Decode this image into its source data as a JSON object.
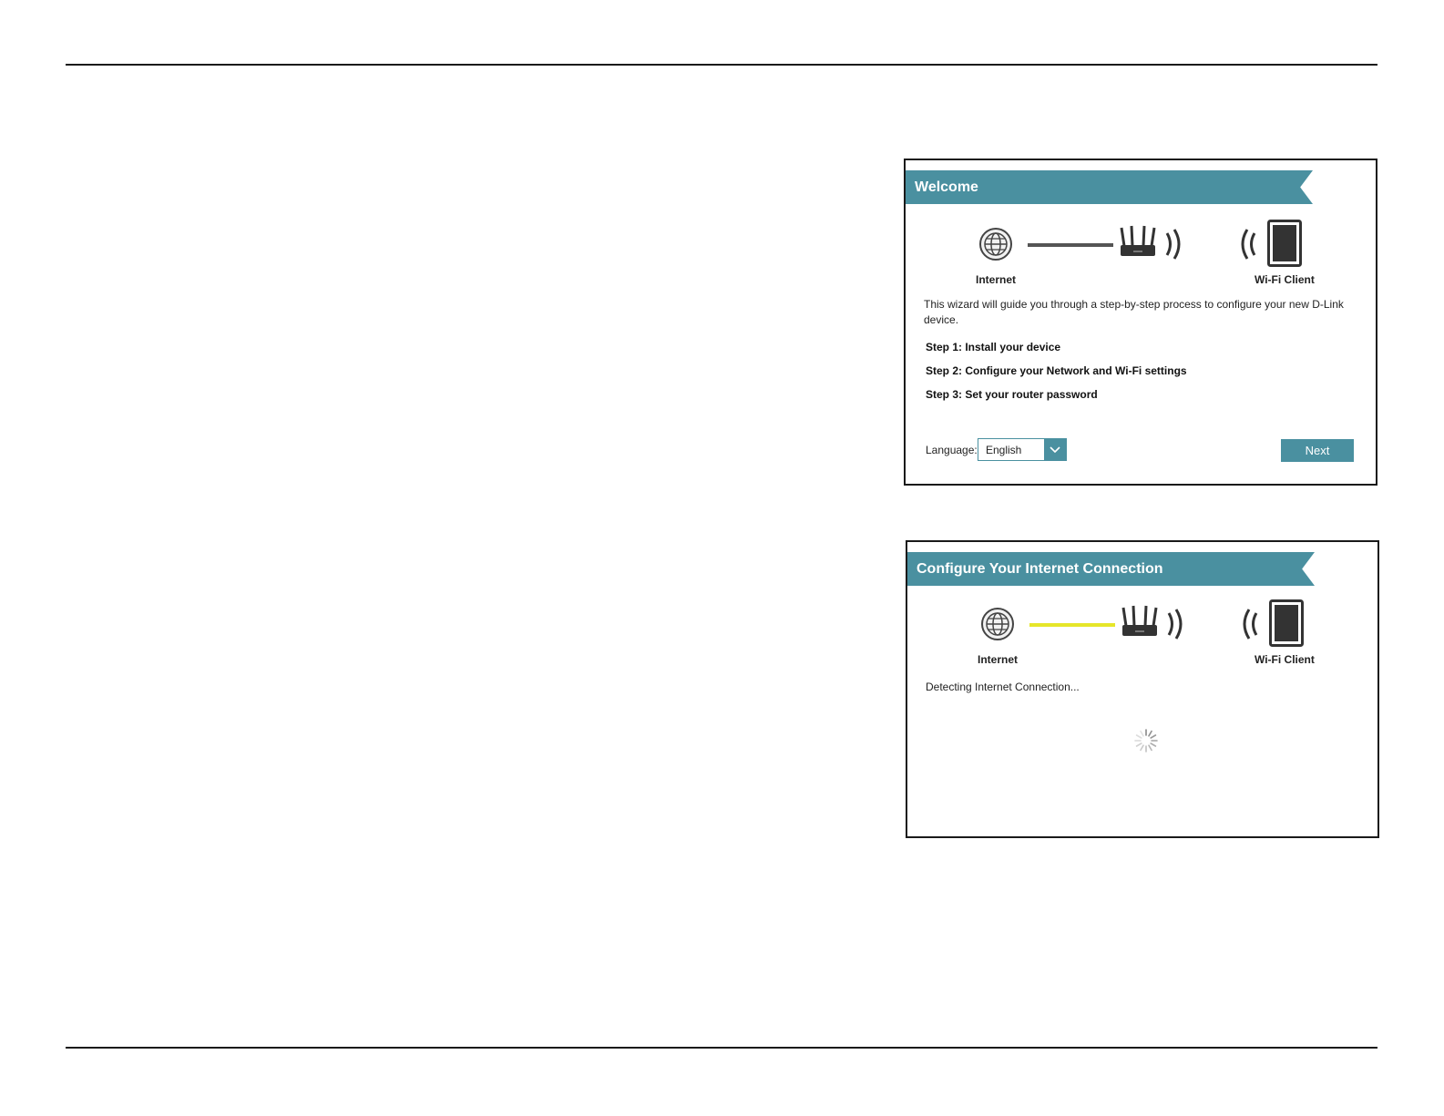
{
  "welcome": {
    "title": "Welcome",
    "diagram": {
      "internet_label": "Internet",
      "client_label": "Wi-Fi Client",
      "link_color": "#555555"
    },
    "description": "This wizard will guide you through a step-by-step process to configure your new D-Link device.",
    "steps": [
      "Step 1: Install your device",
      "Step 2: Configure your Network and Wi-Fi settings",
      "Step 3: Set your router password"
    ],
    "language_label": "Language:",
    "language_value": "English",
    "next_label": "Next"
  },
  "connect": {
    "title": "Configure Your Internet Connection",
    "diagram": {
      "internet_label": "Internet",
      "client_label": "Wi-Fi Client",
      "link_color": "#e6e62a"
    },
    "status": "Detecting Internet Connection..."
  },
  "colors": {
    "accent": "#4a90a0"
  }
}
